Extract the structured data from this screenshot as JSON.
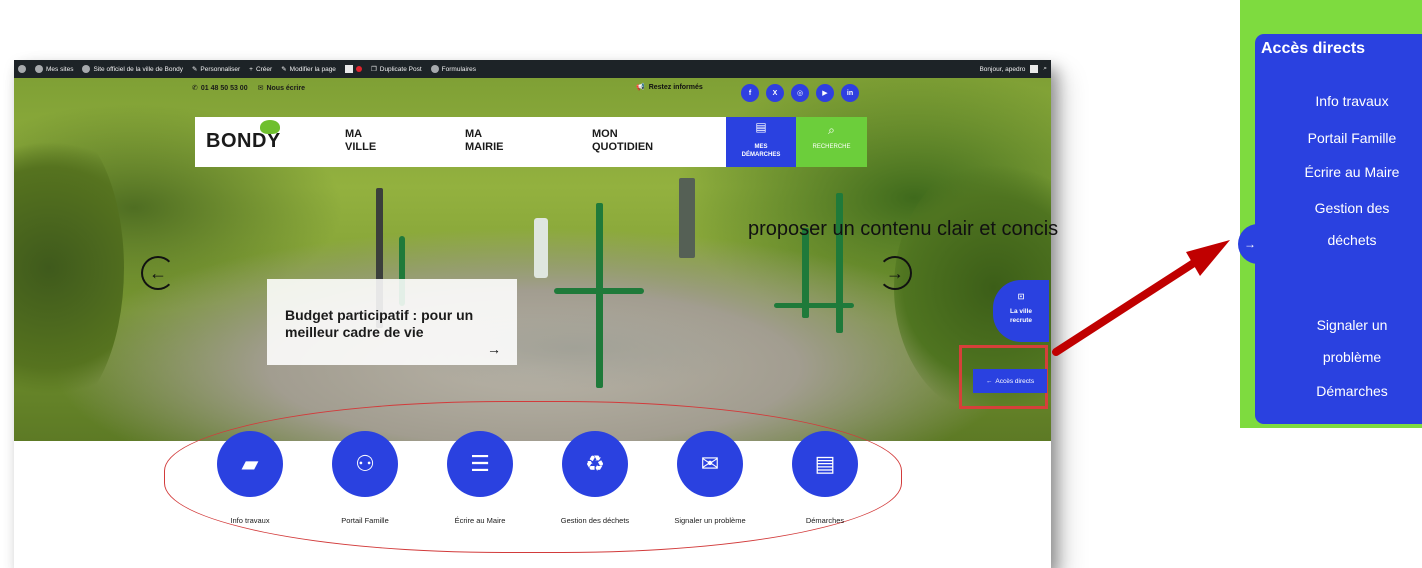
{
  "admin_bar": {
    "my_sites": "Mes sites",
    "site_name": "Site officiel de la ville de Bondy",
    "customize": "Personnaliser",
    "create": "Créer",
    "edit_page": "Modifier la page",
    "duplicate": "Duplicate Post",
    "forms": "Formulaires",
    "greeting": "Bonjour, apedro"
  },
  "header": {
    "phone": "01 48 50 53 00",
    "contact": "Nous écrire",
    "stay_informed": "Restez informés",
    "social": [
      "f",
      "X",
      "◎",
      "▶",
      "in"
    ]
  },
  "nav": {
    "logo": "BONDY",
    "items": [
      {
        "line1": "MA",
        "line2": "VILLE"
      },
      {
        "line1": "MA",
        "line2": "MAIRIE"
      },
      {
        "line1": "MON",
        "line2": "QUOTIDIEN"
      }
    ],
    "demarches_line1": "MES",
    "demarches_line2": "DÉMARCHES",
    "search": "RECHERCHE"
  },
  "hero": {
    "caption": "Budget participatif : pour un meilleur cadre de vie",
    "prev_arrow": "←",
    "next_arrow": "→",
    "caption_arrow": "→"
  },
  "side": {
    "recrute_line1": "La ville",
    "recrute_line2": "recrute",
    "acces": "Accès directs",
    "acces_arrow": "←"
  },
  "tiles": [
    {
      "label": "Info travaux",
      "icon": "barrier-icon",
      "glyph": "▰"
    },
    {
      "label": "Portail Famille",
      "icon": "family-icon",
      "glyph": "⚇"
    },
    {
      "label": "Écrire au Maire",
      "icon": "people-screen-icon",
      "glyph": "☰"
    },
    {
      "label": "Gestion des déchets",
      "icon": "recycle-tree-icon",
      "glyph": "♻"
    },
    {
      "label": "Signaler un problème",
      "icon": "speech-icon",
      "glyph": "✉"
    },
    {
      "label": "Démarches",
      "icon": "document-icon",
      "glyph": "▤"
    }
  ],
  "annotation": "proposer un contenu clair et concis",
  "zoom_panel": {
    "title": "Accès directs",
    "tab_arrow": "→",
    "items": [
      "Info travaux",
      "Portail Famille",
      "Écrire au Maire",
      "Gestion des",
      "déchets",
      "Signaler un",
      "problème",
      "Démarches"
    ]
  },
  "colors": {
    "primary": "#2a41e0",
    "green": "#6cce3b",
    "annotation_red": "#c00000"
  }
}
